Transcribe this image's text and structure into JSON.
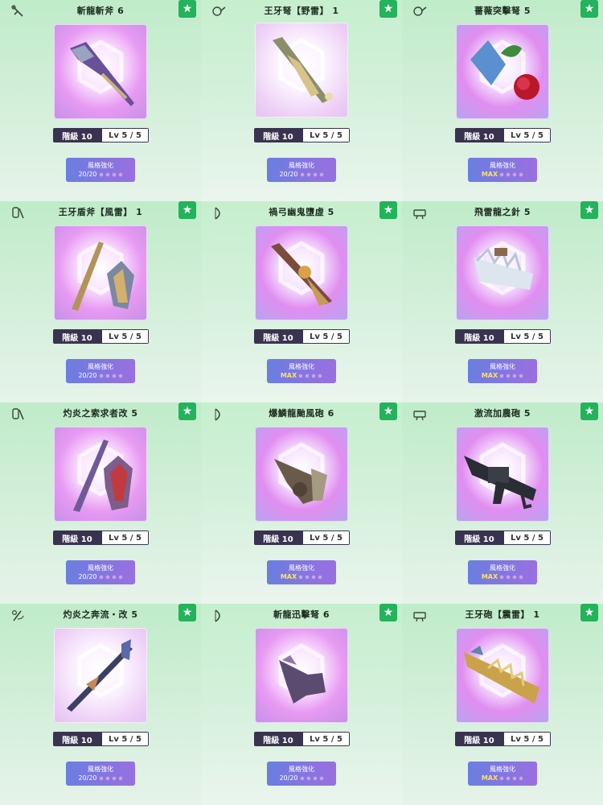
{
  "colors": {
    "panel": "#c6efce",
    "star": "#22b35b",
    "rank_dark": "#3a3350",
    "style_btn": "#8476e0",
    "max": "#ffe066"
  },
  "common": {
    "rank_label": "階級 10",
    "level_label": "Lv 5 / 5",
    "style_label": "風格強化",
    "star_icon": "★"
  },
  "weapons": [
    {
      "name": "斬龍斬斧 6",
      "type_icon": "switch-axe-icon",
      "status": "20/20",
      "art": "axe"
    },
    {
      "name": "王牙弩【野雷】 1",
      "type_icon": "bowgun-icon",
      "status": "20/20",
      "art": "bowgun"
    },
    {
      "name": "薔薇突擊弩 5",
      "type_icon": "bowgun-icon",
      "status": "MAX",
      "art": "rose"
    },
    {
      "name": "王牙盾斧【風雷】 1",
      "type_icon": "charge-blade-icon",
      "status": "20/20",
      "art": "charge"
    },
    {
      "name": "禍弓幽鬼墮虛 5",
      "type_icon": "bow-icon",
      "status": "MAX",
      "art": "bowdark"
    },
    {
      "name": "飛雷龍之針 5",
      "type_icon": "heavy-bowgun-icon",
      "status": "MAX",
      "art": "needle"
    },
    {
      "name": "灼炎之索求者改 5",
      "type_icon": "charge-blade-icon",
      "status": "20/20",
      "art": "charge2"
    },
    {
      "name": "爆鱗龍颱風砲 6",
      "type_icon": "bow-icon",
      "status": "MAX",
      "art": "cannon"
    },
    {
      "name": "激流加農砲 5",
      "type_icon": "heavy-bowgun-icon",
      "status": "MAX",
      "art": "gun"
    },
    {
      "name": "灼炎之奔流・改 5",
      "type_icon": "insect-glaive-icon",
      "status": "20/20",
      "art": "glaive"
    },
    {
      "name": "斬龍迅擊弩 6",
      "type_icon": "bow-icon",
      "status": "20/20",
      "art": "dragon"
    },
    {
      "name": "王牙砲【震雷】 1",
      "type_icon": "heavy-bowgun-icon",
      "status": "MAX",
      "art": "golden"
    }
  ]
}
